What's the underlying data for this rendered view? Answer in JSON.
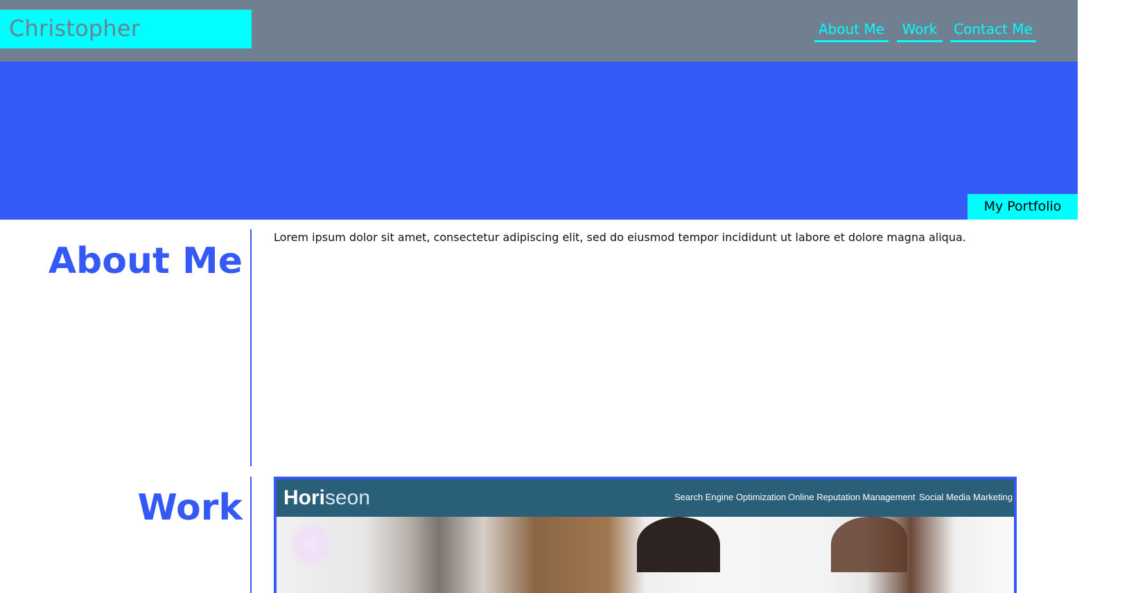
{
  "header": {
    "name": "Christopher",
    "nav": [
      {
        "label": "About Me"
      },
      {
        "label": "Work"
      },
      {
        "label": "Contact Me"
      }
    ]
  },
  "hero": {
    "tag": "My Portfolio"
  },
  "about": {
    "title": "About Me",
    "text": "Lorem ipsum dolor sit amet, consectetur adipiscing elit, sed do eiusmod tempor incididunt ut labore et dolore magna aliqua."
  },
  "work": {
    "title": "Work",
    "project": {
      "logo_main": "Hori",
      "logo_accent": "seon",
      "nav": [
        "Search Engine Optimization",
        "Online Reputation Management",
        "Social Media Marketing"
      ]
    }
  },
  "colors": {
    "header_bg": "#708090",
    "accent_cyan": "#00ffff",
    "brand_blue": "#3559f5",
    "project_header": "#2a5f7a"
  }
}
